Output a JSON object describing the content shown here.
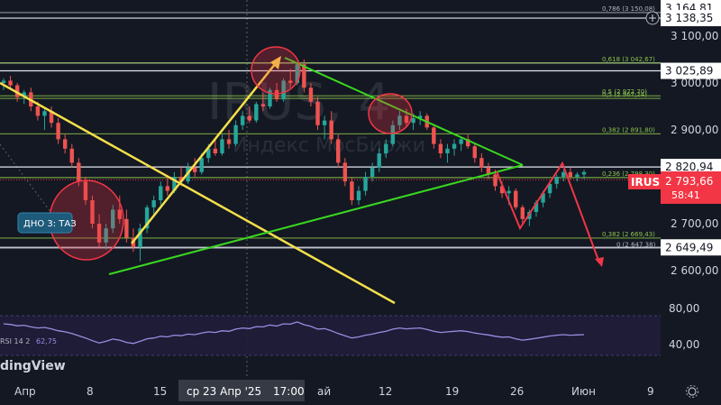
{
  "chart_data": {
    "type": "candlestick",
    "symbol": "IRUS",
    "watermark_symbol": "IRUS, 4",
    "watermark_subtitle": "Индекс МосБиржи",
    "logo_text": "dingView",
    "current_price": "2 793,66",
    "countdown": "58:41",
    "price_axis_ticks": [
      "3 100,00",
      "3 000,00",
      "2 900,00",
      "2 800,00",
      "2 700,00",
      "2 600,00"
    ],
    "price_badges": [
      {
        "label": "3 164,81",
        "value": 3164.81
      },
      {
        "label": "3 138,35",
        "value": 3138.35
      },
      {
        "label": "3 025,89",
        "value": 3025.89
      },
      {
        "label": "2 820,94",
        "value": 2820.94
      },
      {
        "label": "2 649,49",
        "value": 2649.49
      }
    ],
    "fib_upper": [
      {
        "label": "0,786 (3 150,08)",
        "value": 3150.08
      },
      {
        "label": "0,618 (3 042,67)",
        "value": 3042.67
      },
      {
        "label": "0,5 (2 972,70)",
        "value": 2972.7
      },
      {
        "label": "0,5 (2 967,24)",
        "value": 2967.24
      },
      {
        "label": "0,382 (2 891,80)",
        "value": 2891.8
      },
      {
        "label": "0,236 (2 798,30)",
        "value": 2798.3
      }
    ],
    "fib_lower": [
      {
        "label": "0,382 (2 669,43)",
        "value": 2669.43
      },
      {
        "label": "0 (2 647,38)",
        "value": 2647.38
      }
    ],
    "white_levels": [
      3150.08,
      3138.35,
      3042.67,
      3025.89,
      2820.94,
      2649.49
    ],
    "annotation": "ДНО 3: ТАЗ",
    "x_axis_labels": [
      "Апр",
      "8",
      "15",
      "ай",
      "12",
      "19",
      "26",
      "Июн",
      "9"
    ],
    "crosshair_date": "ср 23 Апр '25",
    "crosshair_time": "17:00",
    "indicator_label": "RSI 14 2",
    "indicator_value": "62,75",
    "indicator_axis_ticks": [
      "80,00",
      "40,00"
    ],
    "candles": [
      [
        3000,
        3010,
        2985,
        3005
      ],
      [
        3005,
        3015,
        2990,
        2995
      ],
      [
        2995,
        3000,
        2960,
        2970
      ],
      [
        2970,
        2985,
        2955,
        2980
      ],
      [
        2980,
        2990,
        2940,
        2950
      ],
      [
        2950,
        2960,
        2920,
        2930
      ],
      [
        2930,
        2945,
        2900,
        2940
      ],
      [
        2940,
        2950,
        2905,
        2915
      ],
      [
        2915,
        2925,
        2870,
        2880
      ],
      [
        2880,
        2890,
        2850,
        2860
      ],
      [
        2860,
        2870,
        2820,
        2830
      ],
      [
        2830,
        2840,
        2780,
        2790
      ],
      [
        2790,
        2800,
        2740,
        2750
      ],
      [
        2750,
        2760,
        2690,
        2700
      ],
      [
        2700,
        2720,
        2650,
        2660
      ],
      [
        2660,
        2700,
        2645,
        2690
      ],
      [
        2690,
        2740,
        2680,
        2730
      ],
      [
        2730,
        2760,
        2700,
        2710
      ],
      [
        2710,
        2730,
        2660,
        2670
      ],
      [
        2670,
        2690,
        2640,
        2650
      ],
      [
        2650,
        2700,
        2620,
        2690
      ],
      [
        2690,
        2740,
        2680,
        2735
      ],
      [
        2735,
        2760,
        2720,
        2750
      ],
      [
        2750,
        2790,
        2740,
        2780
      ],
      [
        2780,
        2800,
        2760,
        2770
      ],
      [
        2770,
        2810,
        2765,
        2800
      ],
      [
        2800,
        2820,
        2780,
        2790
      ],
      [
        2790,
        2830,
        2785,
        2820
      ],
      [
        2820,
        2840,
        2800,
        2810
      ],
      [
        2810,
        2850,
        2805,
        2840
      ],
      [
        2840,
        2870,
        2830,
        2860
      ],
      [
        2860,
        2880,
        2845,
        2850
      ],
      [
        2850,
        2890,
        2845,
        2880
      ],
      [
        2880,
        2900,
        2860,
        2870
      ],
      [
        2870,
        2920,
        2865,
        2910
      ],
      [
        2910,
        2940,
        2900,
        2930
      ],
      [
        2930,
        2950,
        2915,
        2920
      ],
      [
        2920,
        2960,
        2915,
        2955
      ],
      [
        2955,
        2980,
        2940,
        2950
      ],
      [
        2950,
        2990,
        2945,
        2985
      ],
      [
        2985,
        3000,
        2960,
        2965
      ],
      [
        2965,
        3010,
        2960,
        3005
      ],
      [
        3005,
        3030,
        2990,
        3000
      ],
      [
        3000,
        3045,
        2995,
        3040
      ],
      [
        3040,
        3050,
        2980,
        2990
      ],
      [
        2990,
        3000,
        2950,
        2960
      ],
      [
        2960,
        2970,
        2900,
        2910
      ],
      [
        2910,
        2930,
        2880,
        2920
      ],
      [
        2920,
        2940,
        2870,
        2880
      ],
      [
        2880,
        2890,
        2820,
        2830
      ],
      [
        2830,
        2840,
        2780,
        2790
      ],
      [
        2790,
        2800,
        2740,
        2750
      ],
      [
        2750,
        2780,
        2740,
        2770
      ],
      [
        2770,
        2810,
        2760,
        2800
      ],
      [
        2800,
        2830,
        2790,
        2820
      ],
      [
        2820,
        2860,
        2810,
        2850
      ],
      [
        2850,
        2880,
        2840,
        2870
      ],
      [
        2870,
        2920,
        2865,
        2910
      ],
      [
        2910,
        2940,
        2900,
        2930
      ],
      [
        2930,
        2945,
        2905,
        2915
      ],
      [
        2915,
        2935,
        2900,
        2925
      ],
      [
        2925,
        2940,
        2910,
        2930
      ],
      [
        2930,
        2935,
        2900,
        2905
      ],
      [
        2905,
        2910,
        2860,
        2870
      ],
      [
        2870,
        2880,
        2840,
        2850
      ],
      [
        2850,
        2870,
        2830,
        2860
      ],
      [
        2860,
        2880,
        2845,
        2870
      ],
      [
        2870,
        2885,
        2855,
        2880
      ],
      [
        2880,
        2890,
        2860,
        2865
      ],
      [
        2865,
        2870,
        2830,
        2840
      ],
      [
        2840,
        2850,
        2810,
        2820
      ],
      [
        2820,
        2830,
        2795,
        2805
      ],
      [
        2805,
        2815,
        2770,
        2780
      ],
      [
        2780,
        2790,
        2755,
        2765
      ],
      [
        2765,
        2780,
        2740,
        2770
      ],
      [
        2770,
        2775,
        2730,
        2735
      ],
      [
        2735,
        2740,
        2700,
        2710
      ],
      [
        2710,
        2730,
        2695,
        2725
      ],
      [
        2725,
        2750,
        2715,
        2745
      ],
      [
        2745,
        2770,
        2735,
        2765
      ],
      [
        2765,
        2790,
        2755,
        2785
      ],
      [
        2785,
        2805,
        2775,
        2800
      ],
      [
        2800,
        2815,
        2790,
        2810
      ],
      [
        2810,
        2820,
        2795,
        2800
      ],
      [
        2800,
        2810,
        2790,
        2805
      ],
      [
        2805,
        2815,
        2795,
        2810
      ]
    ]
  }
}
